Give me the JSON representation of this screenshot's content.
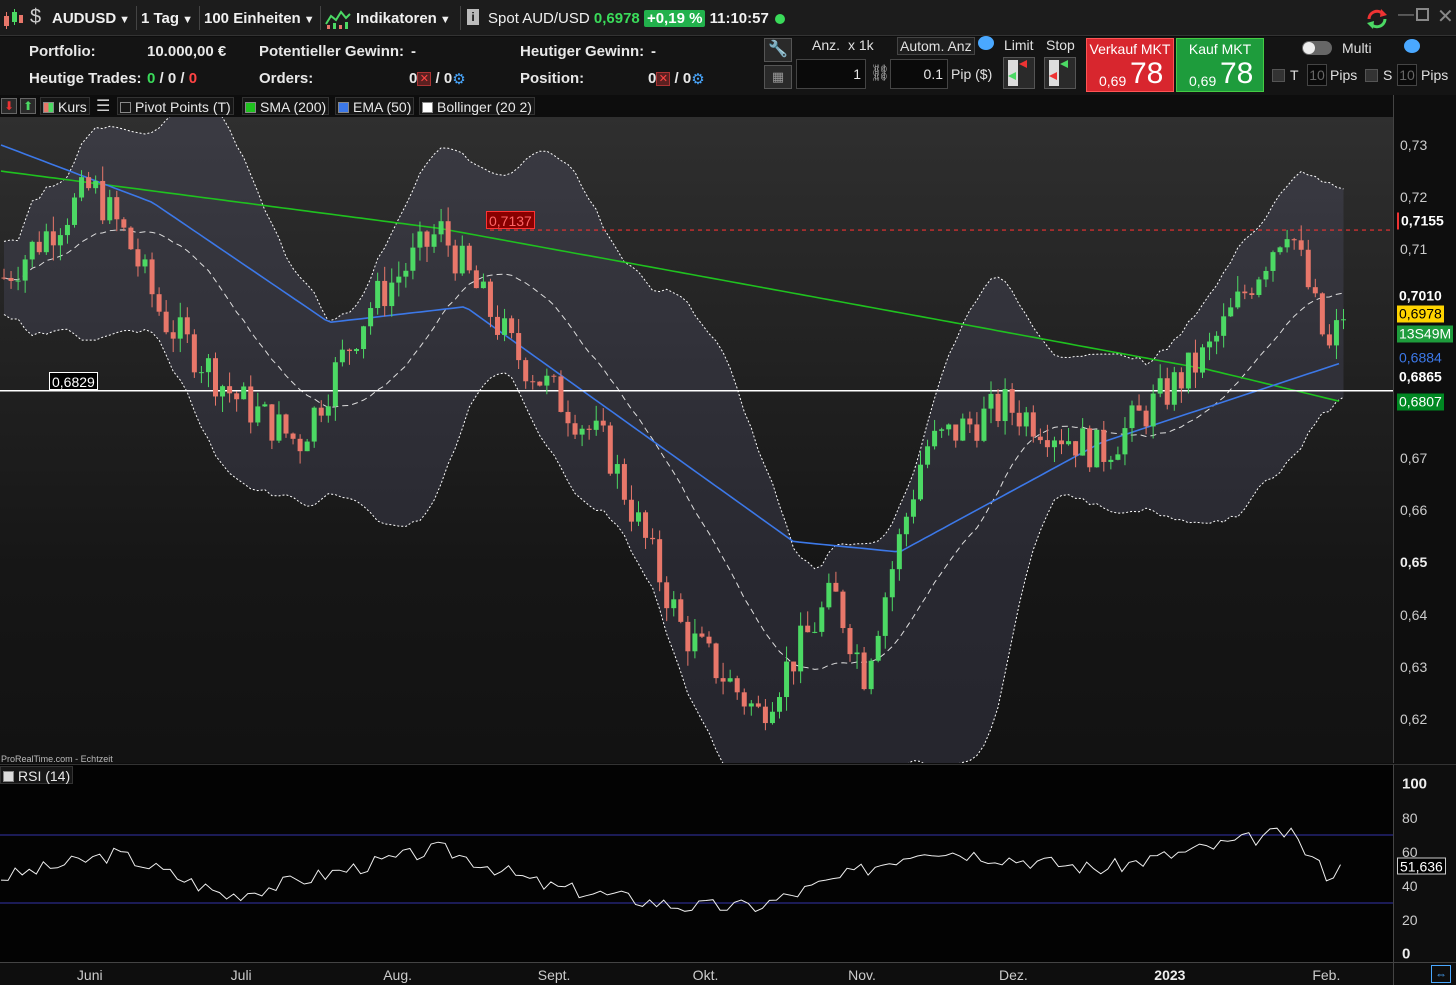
{
  "toolbar": {
    "symbol": "AUDUSD",
    "timeframe": "1 Tag",
    "units": "100 Einheiten",
    "indicators_label": "Indikatoren",
    "spot_label": "Spot AUD/USD",
    "spot_price": "0,6978",
    "change": "+0,19 %",
    "time": "11:10:57"
  },
  "portfolio": {
    "portfolio_label": "Portfolio:",
    "portfolio_value": "10.000,00 €",
    "potential_gain_label": "Potentieller Gewinn:",
    "potential_gain_value": "-",
    "today_gain_label": "Heutiger Gewinn:",
    "today_gain_value": "-",
    "today_trades_label": "Heutige Trades:",
    "today_trades_a": "0",
    "today_trades_sep1": "/",
    "today_trades_b": "0",
    "today_trades_sep2": "/",
    "today_trades_c": "0",
    "orders_label": "Orders:",
    "orders_a": "0",
    "orders_b": "/ 0",
    "position_label": "Position:",
    "position_a": "0",
    "position_b": "/ 0"
  },
  "trade": {
    "qty_label": "Anz.",
    "qty_unit": "x 1k",
    "auto_qty_label": "Autom. Anz",
    "qty_value": "1",
    "pip_value": "0.1",
    "pip_unit": "Pip ($)",
    "limit_label": "Limit",
    "stop_label": "Stop",
    "sell_label": "Verkauf MKT",
    "sell_small": "0,69",
    "sell_big": "78",
    "buy_label": "Kauf MKT",
    "buy_small": "0,69",
    "buy_big": "78",
    "multi_label": "Multi",
    "t_label": "T",
    "t_value": "10",
    "s_label": "S",
    "s_value": "10",
    "pips_label": "Pips"
  },
  "legend": {
    "price": "Kurs",
    "pivot": "Pivot Points (T)",
    "sma": "SMA (200)",
    "ema": "EMA (50)",
    "bollinger": "Bollinger (20 2)"
  },
  "watermark": "ProRealTime.com - Echtzeit",
  "annotations": {
    "high_label": "0,7137",
    "low_label": "0,6829"
  },
  "price_axis": {
    "ticks": [
      "0,73",
      "0,72",
      "0,71",
      "0,70",
      "0,69",
      "0,68",
      "0,67",
      "0,66",
      "0,65",
      "0,64",
      "0,63",
      "0,62"
    ],
    "badge_high": "0,7155",
    "badge_1": "0,7010",
    "badge_price": "0,6978",
    "badge_timer": "13S49M",
    "badge_ema": "0,6884",
    "badge_2": "0,6865",
    "badge_sma": "0,6807"
  },
  "rsi": {
    "label": "RSI (14)",
    "value": "51,636",
    "ticks": [
      "100",
      "80",
      "60",
      "40",
      "20",
      "0"
    ]
  },
  "time_axis": {
    "labels": [
      "Juni",
      "Juli",
      "Aug.",
      "Sept.",
      "Okt.",
      "Nov.",
      "Dez.",
      "2023",
      "Feb."
    ]
  },
  "colors": {
    "up": "#4cd964",
    "down": "#e8776a",
    "sma": "#1fc21f",
    "ema": "#3c78e8",
    "band": "#ffffff",
    "sell": "#d8262e",
    "buy": "#1e9c3c"
  },
  "chart_data": {
    "type": "candlestick",
    "symbol": "AUDUSD",
    "y_range": [
      0.615,
      0.735
    ],
    "x_range": [
      "2022-05-16",
      "2023-02-15"
    ],
    "x_ticks": [
      "Juni",
      "Juli",
      "Aug.",
      "Sept.",
      "Okt.",
      "Nov.",
      "Dez.",
      "2023",
      "Feb."
    ],
    "close_path": [
      {
        "x": "2022-05-16",
        "y": 0.704
      },
      {
        "x": "2022-06-03",
        "y": 0.722
      },
      {
        "x": "2022-06-10",
        "y": 0.712
      },
      {
        "x": "2022-06-17",
        "y": 0.697
      },
      {
        "x": "2022-07-01",
        "y": 0.682
      },
      {
        "x": "2022-07-14",
        "y": 0.673
      },
      {
        "x": "2022-07-28",
        "y": 0.699
      },
      {
        "x": "2022-08-11",
        "y": 0.7137
      },
      {
        "x": "2022-08-26",
        "y": 0.69
      },
      {
        "x": "2022-09-13",
        "y": 0.672
      },
      {
        "x": "2022-09-28",
        "y": 0.637
      },
      {
        "x": "2022-10-13",
        "y": 0.621
      },
      {
        "x": "2022-10-28",
        "y": 0.644
      },
      {
        "x": "2022-11-03",
        "y": 0.629
      },
      {
        "x": "2022-11-15",
        "y": 0.672
      },
      {
        "x": "2022-12-01",
        "y": 0.68
      },
      {
        "x": "2022-12-20",
        "y": 0.671
      },
      {
        "x": "2023-01-10",
        "y": 0.69
      },
      {
        "x": "2023-01-26",
        "y": 0.7155
      },
      {
        "x": "2023-02-03",
        "y": 0.69
      },
      {
        "x": "2023-02-06",
        "y": 0.6978
      }
    ],
    "sma_200": [
      {
        "x": "2022-05-16",
        "y": 0.725
      },
      {
        "x": "2022-08-11",
        "y": 0.714
      },
      {
        "x": "2022-11-15",
        "y": 0.697
      },
      {
        "x": "2023-01-10",
        "y": 0.687
      },
      {
        "x": "2023-02-06",
        "y": 0.6807
      }
    ],
    "ema_50": [
      {
        "x": "2022-05-16",
        "y": 0.73
      },
      {
        "x": "2022-06-15",
        "y": 0.719
      },
      {
        "x": "2022-07-20",
        "y": 0.696
      },
      {
        "x": "2022-08-16",
        "y": 0.699
      },
      {
        "x": "2022-10-20",
        "y": 0.654
      },
      {
        "x": "2022-11-10",
        "y": 0.652
      },
      {
        "x": "2022-12-20",
        "y": 0.673
      },
      {
        "x": "2023-02-06",
        "y": 0.6884
      }
    ],
    "levels": {
      "resistance": 0.7137,
      "support": 0.6829,
      "high": 0.7155
    },
    "rsi_14": [
      {
        "x": "2022-05-16",
        "y": 45
      },
      {
        "x": "2022-06-08",
        "y": 59
      },
      {
        "x": "2022-06-30",
        "y": 34
      },
      {
        "x": "2022-08-11",
        "y": 62
      },
      {
        "x": "2022-09-01",
        "y": 40
      },
      {
        "x": "2022-09-28",
        "y": 28
      },
      {
        "x": "2022-10-13",
        "y": 28
      },
      {
        "x": "2022-11-15",
        "y": 62
      },
      {
        "x": "2022-12-20",
        "y": 50
      },
      {
        "x": "2023-01-26",
        "y": 72
      },
      {
        "x": "2023-02-03",
        "y": 46
      },
      {
        "x": "2023-02-06",
        "y": 51.636
      }
    ],
    "rsi_range": [
      0,
      100
    ]
  }
}
